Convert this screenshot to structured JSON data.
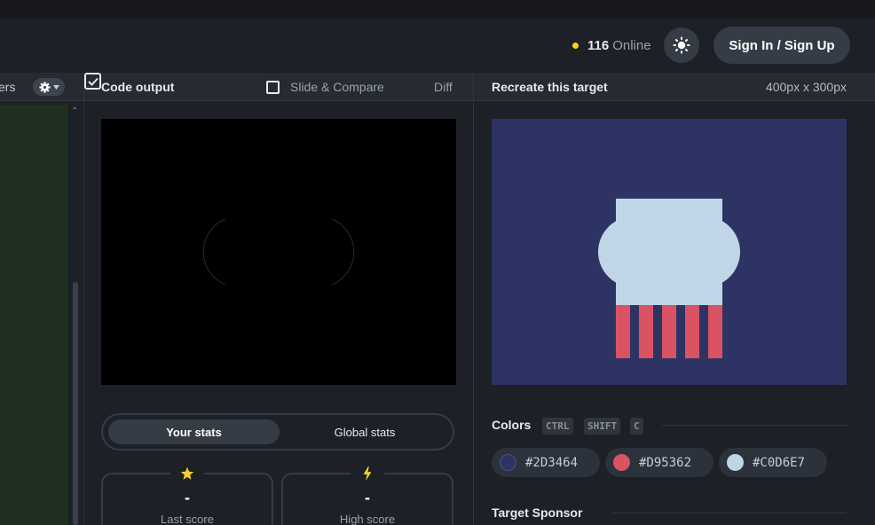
{
  "header": {
    "online_count": "116",
    "online_label": "Online",
    "signin_label": "Sign In / Sign Up"
  },
  "left_panel": {
    "tab_label_partial": "ers"
  },
  "output": {
    "title": "Code output",
    "slide_compare_label": "Slide & Compare",
    "slide_compare_checked": false,
    "diff_label": "Diff",
    "diff_checked": true
  },
  "stats": {
    "tab_your": "Your stats",
    "tab_global": "Global stats",
    "last_score_value": "-",
    "last_score_label": "Last score",
    "high_score_value": "-",
    "high_score_label": "High score"
  },
  "target": {
    "title": "Recreate this target",
    "dimensions": "400px x 300px"
  },
  "colors": {
    "title": "Colors",
    "kbd_ctrl": "CTRL",
    "kbd_shift": "SHIFT",
    "kbd_c": "C",
    "swatches": [
      {
        "hex": "#2D3464",
        "color": "#2d3464"
      },
      {
        "hex": "#D95362",
        "color": "#d95362"
      },
      {
        "hex": "#C0D6E7",
        "color": "#c0d6e7"
      }
    ]
  },
  "sponsor": {
    "title": "Target Sponsor"
  },
  "theme": {
    "accent": "#f7d02c",
    "panel_bg": "#1d2026",
    "button_bg": "#363c46"
  },
  "icons": {
    "theme_toggle": "sun-icon",
    "settings": "gear-icon",
    "last_score": "star-icon",
    "high_score": "lightning-icon"
  }
}
